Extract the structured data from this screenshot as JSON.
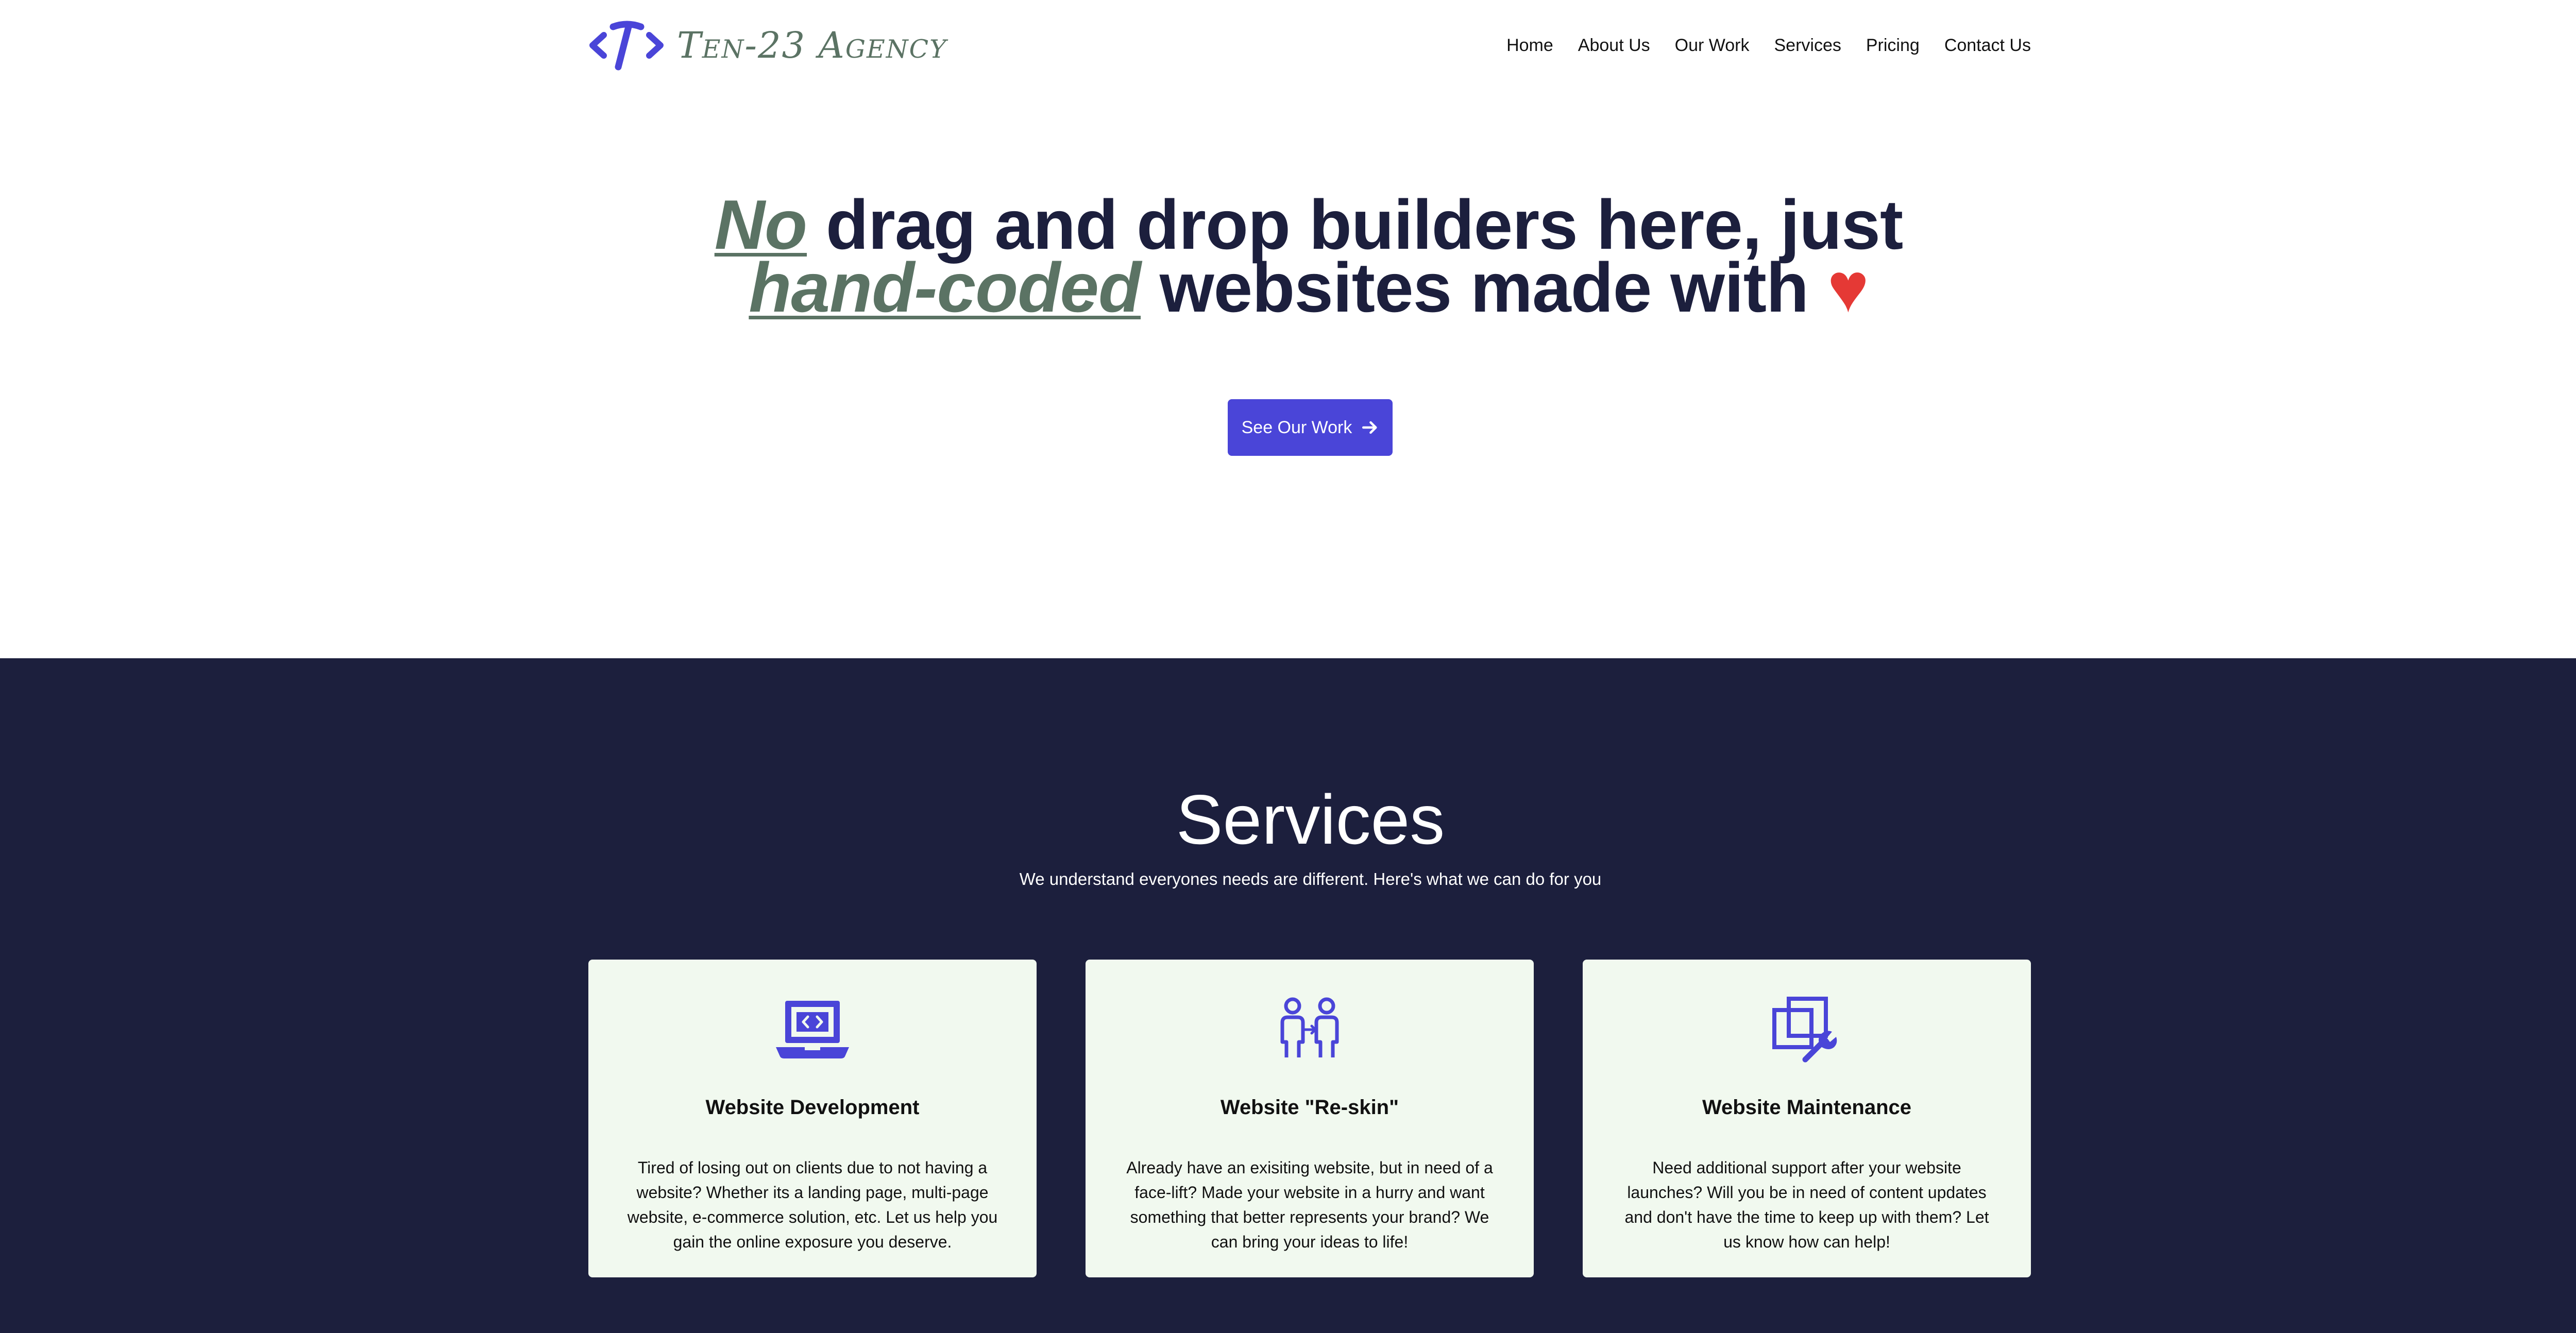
{
  "header": {
    "logo_text": "Ten-23 Agency",
    "nav": [
      "Home",
      "About Us",
      "Our Work",
      "Services",
      "Pricing",
      "Contact Us"
    ]
  },
  "hero": {
    "title_parts": {
      "accent1": "No",
      "text1": " drag and drop builders here, just ",
      "accent2": "hand-coded",
      "text2": " websites made with ",
      "heart": "♥"
    },
    "cta_label": "See Our Work"
  },
  "services": {
    "title": "Services",
    "subtitle": "We understand everyones needs are different. Here's what we can do for you",
    "cards": [
      {
        "icon": "laptop-code-icon",
        "title": "Website Development",
        "text": "Tired of losing out on clients due to not having a website? Whether its a landing page, multi-page website, e-commerce solution, etc. Let us help you gain the online exposure you deserve."
      },
      {
        "icon": "people-swap-icon",
        "title": "Website \"Re-skin\"",
        "text": "Already have an exisiting website, but in need of a face-lift? Made your website in a hurry and want something that better represents your brand? We can bring your ideas to life!"
      },
      {
        "icon": "maintenance-wrench-icon",
        "title": "Website Maintenance",
        "text": "Need additional support after your website launches? Will you be in need of content updates and don't have the time to keep up with them? Let us know how can help!"
      }
    ]
  },
  "colors": {
    "navy": "#1c1f3d",
    "accent_green": "#5b7364",
    "primary_button": "#4a45d8",
    "heart_red": "#e53935",
    "card_bg": "#f1f9ef"
  }
}
